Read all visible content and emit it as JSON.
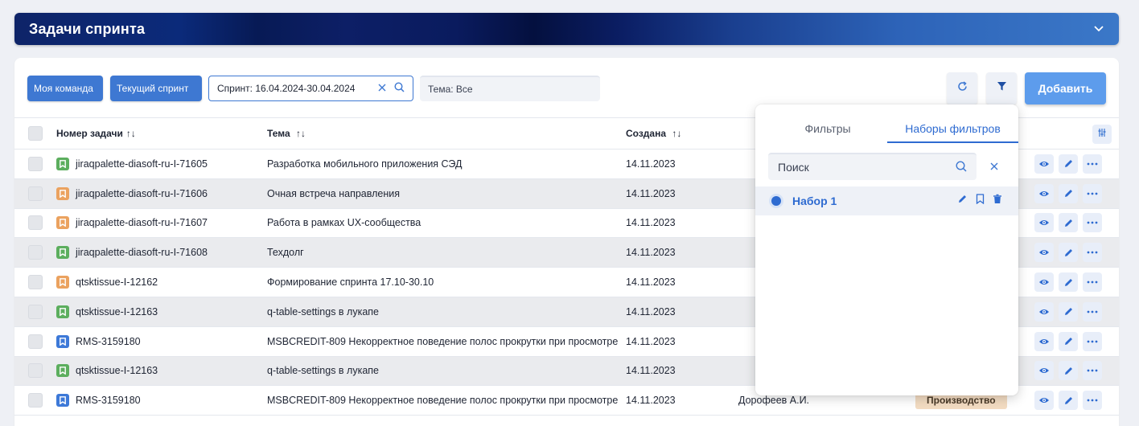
{
  "header": {
    "title": "Задачи спринта",
    "collapse_icon": "chevron-down-icon"
  },
  "toolbar": {
    "my_team_label": "Моя команда",
    "current_sprint_label": "Текущий спринт",
    "sprint_filter_value": "Спринт: 16.04.2024-30.04.2024",
    "topic_filter_value": "Тема: Все",
    "add_label": "Добавить"
  },
  "table": {
    "columns": {
      "number": "Номер задачи",
      "theme": "Тема",
      "created": "Создана"
    },
    "sort_glyph": "↑↓",
    "rows": [
      {
        "type": "green",
        "number": "jiraqpalette-diasoft-ru-I-71605",
        "theme": "Разработка мобильного приложения СЭД",
        "created": "14.11.2023",
        "author": "",
        "stage": ""
      },
      {
        "type": "orange",
        "number": "jiraqpalette-diasoft-ru-I-71606",
        "theme": "Очная встреча направления",
        "created": "14.11.2023",
        "author": "",
        "stage": ""
      },
      {
        "type": "orange",
        "number": "jiraqpalette-diasoft-ru-I-71607",
        "theme": "Работа в рамках UX-сообщества",
        "created": "14.11.2023",
        "author": "",
        "stage": ""
      },
      {
        "type": "green",
        "number": "jiraqpalette-diasoft-ru-I-71608",
        "theme": "Техдолг",
        "created": "14.11.2023",
        "author": "",
        "stage": ""
      },
      {
        "type": "orange",
        "number": "qtsktissue-I-12162",
        "theme": "Формирование спринта 17.10-30.10",
        "created": "14.11.2023",
        "author": "",
        "stage": ""
      },
      {
        "type": "green",
        "number": "qtsktissue-I-12163",
        "theme": "q-table-settings в лукапе",
        "created": "14.11.2023",
        "author": "",
        "stage": ""
      },
      {
        "type": "blue",
        "number": "RMS-3159180",
        "theme": "MSBCREDIT-809 Некорректное поведение полос прокрутки при просмотре",
        "created": "14.11.2023",
        "author": "",
        "stage": ""
      },
      {
        "type": "green",
        "number": "qtsktissue-I-12163",
        "theme": "q-table-settings в лукапе",
        "created": "14.11.2023",
        "author": "",
        "stage": ""
      },
      {
        "type": "blue",
        "number": "RMS-3159180",
        "theme": "MSBCREDIT-809 Некорректное поведение полос прокрутки при просмотре",
        "created": "14.11.2023",
        "author": "Дорофеев А.И.",
        "stage": "Производство"
      }
    ]
  },
  "filter_popover": {
    "tab_filters": "Фильтры",
    "tab_filter_sets": "Наборы фильтров",
    "search_placeholder": "Поиск",
    "sets": [
      {
        "label": "Набор 1",
        "selected": true
      }
    ]
  },
  "colors": {
    "accent": "#3e78d2",
    "tag_green": "#5cae5e",
    "tag_orange": "#eba25f",
    "tag_blue": "#3d79d8",
    "stage_badge": "#f3dcc2"
  }
}
